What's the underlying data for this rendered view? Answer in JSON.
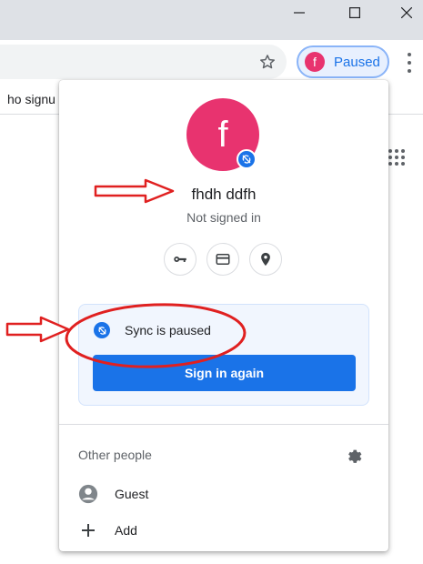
{
  "titlebar": {
    "minimize_icon": "minimize-icon",
    "maximize_icon": "maximize-icon",
    "close_icon": "close-icon"
  },
  "toolbar": {
    "bookmark_icon": "star-icon",
    "profile_initial": "f",
    "profile_label": "Paused",
    "menu_icon": "vertical-dots-icon"
  },
  "bookmarks": {
    "first_item": "ho signu"
  },
  "popup": {
    "avatar_initial": "f",
    "name": "fhdh ddfh",
    "status": "Not signed in",
    "quick_buttons": [
      "key-icon",
      "credit-card-icon",
      "location-pin-icon"
    ],
    "sync": {
      "label": "Sync is paused",
      "button": "Sign in again"
    },
    "other_people": {
      "heading": "Other people",
      "settings_icon": "gear-icon",
      "items": [
        {
          "label": "Guest",
          "icon": "person-circle-icon"
        },
        {
          "label": "Add",
          "icon": "plus-icon"
        }
      ]
    }
  },
  "colors": {
    "accent": "#1a73e8",
    "avatar": "#e8336f",
    "annotation": "#e02020"
  }
}
